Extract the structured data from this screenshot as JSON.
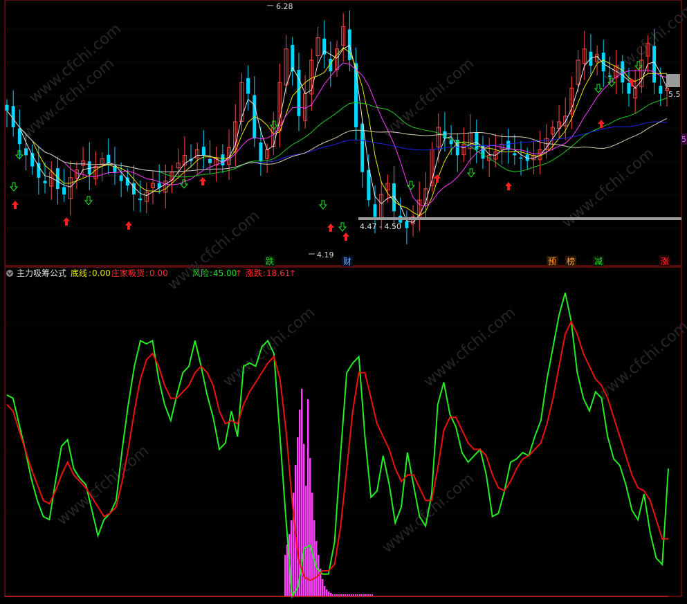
{
  "header": {
    "indicator_name": "主力吸筹公式",
    "fields": [
      {
        "label": "底线",
        "value": "0.00",
        "color": "#e8e800"
      },
      {
        "label": "庄家吸货",
        "value": "0.00",
        "color": "#ff3030"
      },
      {
        "label": "风险",
        "value": "45.00",
        "arrow": "↑",
        "color": "#22dd22"
      },
      {
        "label": "涨跌",
        "value": "18.61",
        "arrow": "↑",
        "color": "#ff3030"
      }
    ]
  },
  "price_panel": {
    "high_label": "6.28",
    "low_label": "4.19",
    "range_label": "4.47 - 4.50",
    "right_cut_label": "5.5",
    "right_edge_label": "5",
    "event_tags": [
      {
        "text": "跌",
        "color": "#22dd22",
        "bg": "#000"
      },
      {
        "text": "财",
        "color": "#6aa8ff",
        "bg": "#000"
      },
      {
        "text": "预",
        "color": "#ff9933",
        "bg": "#2a1800"
      },
      {
        "text": "榜",
        "color": "#ff9933",
        "bg": "#2a1800"
      },
      {
        "text": "减",
        "color": "#22dd22",
        "bg": "#001a00"
      },
      {
        "text": "涨",
        "color": "#ff3030",
        "bg": "#2a0000"
      }
    ]
  },
  "watermark": "www.cfchi.com",
  "colors": {
    "up": "#ff4848",
    "down": "#00d8ff",
    "ma_white": "#e8e8e8",
    "ma_yellow": "#e8e800",
    "ma_magenta": "#ff3cff",
    "ma_green": "#22cc22",
    "ma_blue": "#1a22ee",
    "ma_beige": "#d8d0b0",
    "ind_green": "#22ee22",
    "ind_red": "#ee1111",
    "ind_bar": "#ff40ff",
    "panel_border": "#b01818"
  },
  "chart_data": [
    {
      "type": "candlestick",
      "note_series": [
        "close"
      ],
      "y_range": [
        4.1,
        6.3
      ],
      "close": [
        5.35,
        5.2,
        5.05,
        4.95,
        4.85,
        4.75,
        4.7,
        4.8,
        4.65,
        4.6,
        4.75,
        4.82,
        4.9,
        4.78,
        4.85,
        4.92,
        4.88,
        4.8,
        4.72,
        4.68,
        4.6,
        4.55,
        4.62,
        4.7,
        4.66,
        4.72,
        4.8,
        4.88,
        4.95,
        4.9,
        5.0,
        4.95,
        4.88,
        4.92,
        4.86,
        5.02,
        5.25,
        5.6,
        5.5,
        5.1,
        4.9,
        5.0,
        5.2,
        5.6,
        5.9,
        5.7,
        5.3,
        5.5,
        5.8,
        6.0,
        5.85,
        5.7,
        5.9,
        6.1,
        5.8,
        5.2,
        4.8,
        4.55,
        4.4,
        4.6,
        4.7,
        4.45,
        4.35,
        4.3,
        4.4,
        4.55,
        4.65,
        5.0,
        5.2,
        5.1,
        5.05,
        4.95,
        5.05,
        5.15,
        5.0,
        4.92,
        4.95,
        4.98,
        5.05,
        5.0,
        4.95,
        4.92,
        4.9,
        4.95,
        5.0,
        5.1,
        5.2,
        5.25,
        5.3,
        5.55,
        5.8,
        5.9,
        5.75,
        5.85,
        5.7,
        5.65,
        5.75,
        5.6,
        5.5,
        5.55,
        5.8,
        5.95,
        5.6,
        5.5,
        5.55
      ],
      "high": 6.28,
      "low": 4.19
    },
    {
      "type": "line",
      "series": [
        {
          "name": "",
          "color": "#22ee22",
          "values": [
            63,
            62,
            54,
            46,
            37,
            30,
            25,
            24,
            36,
            47,
            49,
            40,
            37,
            35,
            27,
            19,
            24,
            26,
            30,
            46,
            60,
            72,
            80,
            79,
            80,
            68,
            60,
            55,
            63,
            70,
            72,
            80,
            72,
            63,
            56,
            46,
            48,
            58,
            50,
            72,
            73,
            72,
            78,
            80,
            76,
            50,
            24,
            0,
            3,
            15,
            16,
            9,
            7,
            7,
            17,
            45,
            70,
            73,
            75,
            50,
            31,
            33,
            44,
            35,
            23,
            28,
            45,
            35,
            25,
            22,
            32,
            60,
            67,
            57,
            53,
            45,
            42,
            44,
            46,
            38,
            25,
            26,
            33,
            42,
            43,
            45,
            44,
            50,
            55,
            68,
            78,
            88,
            95,
            86,
            70,
            62,
            58,
            64,
            62,
            50,
            43,
            41,
            35,
            27,
            24,
            32,
            20,
            12,
            10,
            40
          ]
        },
        {
          "name": "",
          "color": "#ee1111",
          "values": [
            60,
            58,
            52,
            46,
            40,
            35,
            30,
            29,
            33,
            38,
            42,
            38,
            36,
            34,
            31,
            28,
            25,
            26,
            28,
            36,
            46,
            58,
            68,
            74,
            76,
            72,
            66,
            62,
            62,
            64,
            66,
            70,
            72,
            70,
            66,
            58,
            54,
            55,
            54,
            60,
            64,
            67,
            70,
            73,
            75,
            68,
            52,
            30,
            12,
            6,
            5,
            6,
            8,
            8,
            10,
            22,
            40,
            58,
            70,
            70,
            62,
            54,
            50,
            46,
            40,
            36,
            38,
            38,
            34,
            30,
            30,
            40,
            52,
            56,
            56,
            52,
            48,
            46,
            46,
            44,
            38,
            34,
            33,
            36,
            40,
            43,
            44,
            46,
            48,
            54,
            62,
            72,
            82,
            86,
            82,
            76,
            72,
            68,
            66,
            62,
            56,
            50,
            44,
            38,
            34,
            33,
            30,
            24,
            18,
            18
          ]
        }
      ]
    }
  ]
}
